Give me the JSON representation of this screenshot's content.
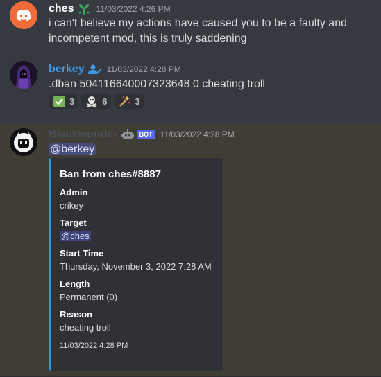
{
  "messages": [
    {
      "username": "ches",
      "timestamp": "11/03/2022 4:26 PM",
      "text": "i can't believe my actions have caused you to be a faulty and incompetent mod, this is truly saddening",
      "avatar_icon": "discord-logo-icon",
      "role_icon": "sprout-icon",
      "name_color": "#ffffff"
    },
    {
      "username": "berkey",
      "timestamp": "11/03/2022 4:28 PM",
      "text": ".dban 504116640007323648 0 cheating troll",
      "avatar_icon": "hooded-figure-icon",
      "role_icon": "user-edit-icon",
      "name_color": "#3d9be9",
      "reactions": [
        {
          "emoji": "check-mark-icon",
          "count": "3"
        },
        {
          "emoji": "skull-crossbones-icon",
          "count": "6"
        },
        {
          "emoji": "sparkle-wand-icon",
          "count": "3"
        }
      ]
    },
    {
      "username": "Blackwonder",
      "timestamp": "11/03/2022 4:28 PM",
      "bot_badge": "BOT",
      "avatar_icon": "robot-face-icon",
      "role_icon": "robot-icon",
      "mention": "@berkey",
      "embed": {
        "title": "Ban from ches#8887",
        "accent_color": "#1d9bea",
        "fields": [
          {
            "name": "Admin",
            "value": "crikey"
          },
          {
            "name": "Target",
            "value": "@ches"
          },
          {
            "name": "Start Time",
            "value": "Thursday, November 3, 2022 7:28 AM"
          },
          {
            "name": "Length",
            "value": "Permanent (0)"
          },
          {
            "name": "Reason",
            "value": "cheating troll"
          }
        ],
        "footer": "11/03/2022 4:28 PM"
      }
    }
  ]
}
